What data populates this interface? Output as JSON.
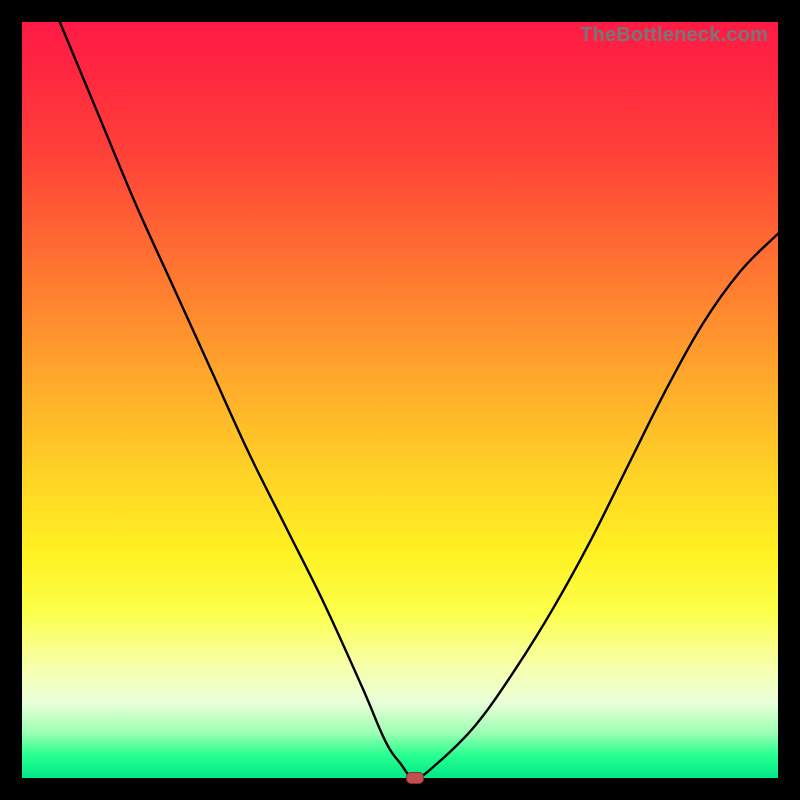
{
  "watermark": "TheBottleneck.com",
  "colors": {
    "frame": "#000000",
    "curve": "#000000",
    "marker_fill": "#c0504d",
    "marker_border": "#8a2f2c"
  },
  "chart_data": {
    "type": "line",
    "title": "",
    "xlabel": "",
    "ylabel": "",
    "xlim": [
      0,
      100
    ],
    "ylim": [
      0,
      100
    ],
    "grid": false,
    "series": [
      {
        "name": "bottleneck-curve",
        "x": [
          5,
          10,
          15,
          20,
          25,
          30,
          35,
          40,
          45,
          48,
          50,
          52,
          55,
          60,
          65,
          70,
          75,
          80,
          85,
          90,
          95,
          100
        ],
        "values": [
          100,
          88,
          76,
          65,
          54,
          43,
          33,
          23,
          12,
          5,
          2,
          0,
          2,
          7,
          14,
          22,
          31,
          41,
          51,
          60,
          67,
          72
        ]
      }
    ],
    "annotations": [
      {
        "name": "marker",
        "x": 52,
        "y": 0
      }
    ]
  }
}
